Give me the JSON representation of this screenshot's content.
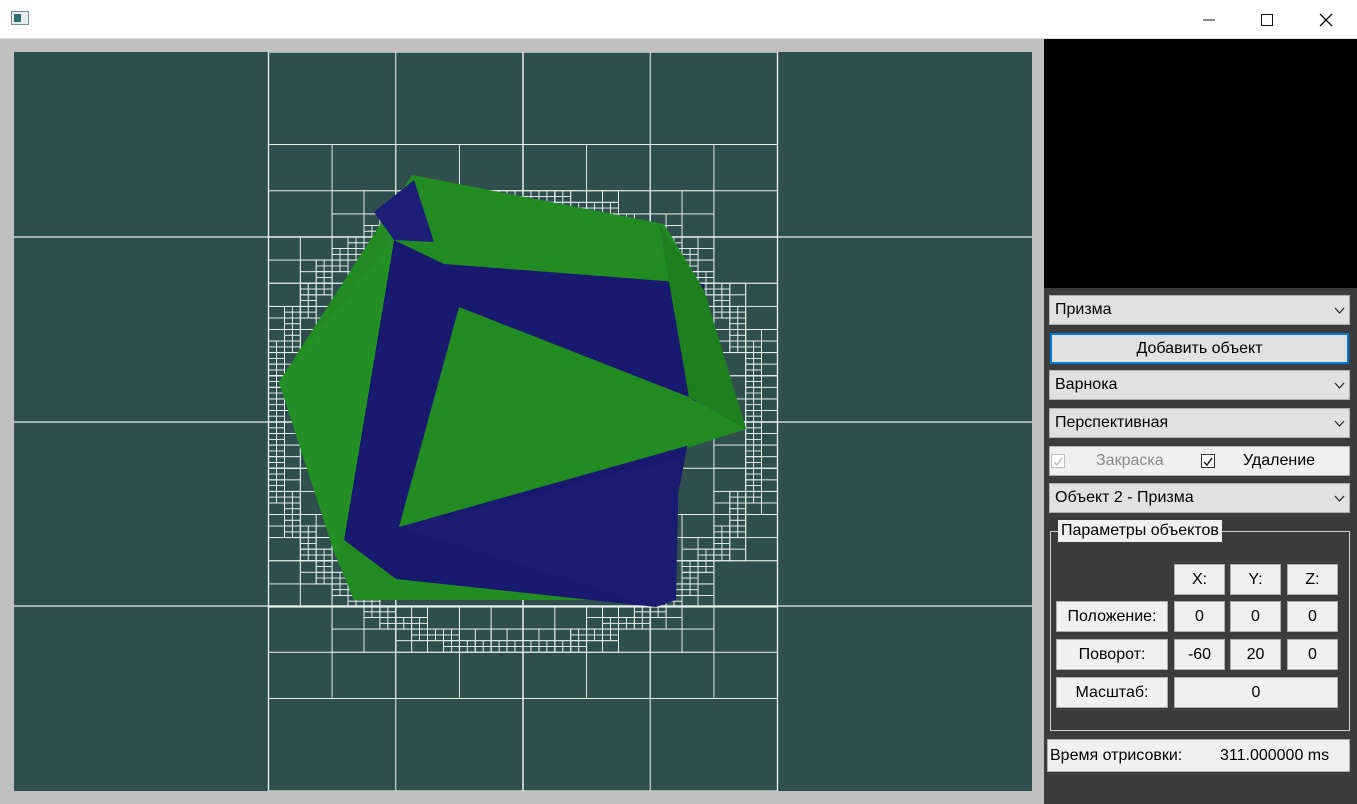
{
  "window": {
    "title": "",
    "minimize_glyph": "—",
    "maximize_glyph": "☐",
    "close_glyph": "✕"
  },
  "viewport": {
    "background_color": "#2f4f4f",
    "grid_color": "#e8f0ee",
    "polygon_colors": {
      "green": "#228b22",
      "blue": "#191970"
    }
  },
  "controls": {
    "primitive_select": "Призма",
    "add_object_button": "Добавить объект",
    "render_mode_select": "Варнока",
    "projection_select": "Перспективная",
    "shading_label": "Закраска",
    "shading_checked": true,
    "shading_enabled": false,
    "removal_label": "Удаление",
    "removal_checked": true,
    "object_select": "Объект 2 - Призма"
  },
  "params": {
    "group_title": "Параметры объектов",
    "headers": {
      "x": "X:",
      "y": "Y:",
      "z": "Z:"
    },
    "position": {
      "label": "Положение:",
      "x": "0",
      "y": "0",
      "z": "0"
    },
    "rotation": {
      "label": "Поворот:",
      "x": "-60",
      "y": "20",
      "z": "0"
    },
    "scale": {
      "label": "Масштаб:",
      "value": "0"
    }
  },
  "status": {
    "label": "Время отрисовки:",
    "value": "311.000000 ms"
  }
}
